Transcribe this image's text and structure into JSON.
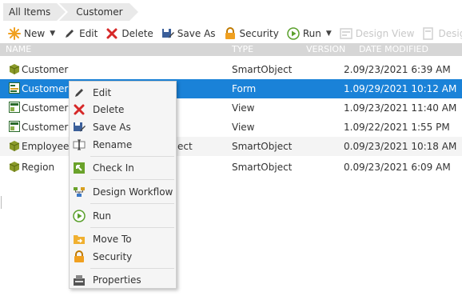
{
  "breadcrumb": {
    "items": [
      "All Items",
      "Customer"
    ]
  },
  "toolbar": {
    "new_label": "New",
    "edit_label": "Edit",
    "delete_label": "Delete",
    "save_as_label": "Save As",
    "security_label": "Security",
    "run_label": "Run",
    "design_view_label": "Design View",
    "design_form_label": "Design Fo"
  },
  "grid": {
    "columns": {
      "name": "NAME",
      "type": "TYPE",
      "version": "VERSION",
      "date": "DATE MODIFIED"
    },
    "rows": [
      {
        "name": "Customer",
        "type": "SmartObject",
        "version": "2.0",
        "date": "9/23/2021 6:39 AM",
        "icon": "smartobject-icon"
      },
      {
        "name": "Customer",
        "type": "Form",
        "version": "1.0",
        "date": "9/29/2021 10:12 AM",
        "icon": "form-icon"
      },
      {
        "name": "Customer I",
        "type": "View",
        "version": "1.0",
        "date": "9/23/2021 11:40 AM",
        "icon": "view-icon"
      },
      {
        "name": "Customer L",
        "type": "View",
        "version": "1.0",
        "date": "9/22/2021 1:55 PM",
        "icon": "view-icon"
      },
      {
        "name": "Employee D",
        "name_tail": "ect",
        "type": "SmartObject",
        "version": "0.0",
        "date": "9/23/2021 10:18 AM",
        "icon": "smartobject-icon"
      },
      {
        "name": "Region",
        "type": "SmartObject",
        "version": "0.0",
        "date": "9/23/2021 6:09 AM",
        "icon": "smartobject-icon"
      }
    ]
  },
  "context_menu": {
    "edit": "Edit",
    "delete": "Delete",
    "save_as": "Save As",
    "rename": "Rename",
    "check_in": "Check In",
    "design_workflow": "Design Workflow",
    "run": "Run",
    "move_to": "Move To",
    "security": "Security",
    "properties": "Properties"
  },
  "colors": {
    "selection": "#1a82d8",
    "header": "#d6d6d6",
    "delete_red": "#d62828",
    "run_green": "#5aa02c"
  }
}
